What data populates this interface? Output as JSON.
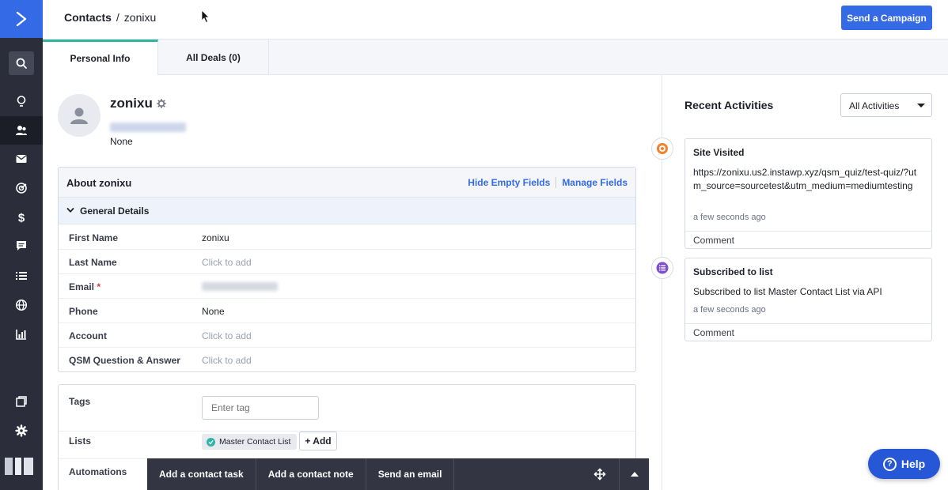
{
  "colors": {
    "brand": "#356ae6",
    "sidebar": "#2b2e3a",
    "accent_tab": "#2eb5a6",
    "required": "#d93b3b"
  },
  "sidebar": {
    "items": [
      {
        "icon": "search-icon"
      },
      {
        "icon": "lightbulb-icon"
      },
      {
        "icon": "contacts-icon"
      },
      {
        "icon": "mail-icon"
      },
      {
        "icon": "automation-icon"
      },
      {
        "icon": "dollar-icon"
      },
      {
        "icon": "chat-icon"
      },
      {
        "icon": "list-icon"
      },
      {
        "icon": "globe-icon"
      },
      {
        "icon": "reports-icon"
      },
      {
        "icon": "pages-icon"
      },
      {
        "icon": "gear-icon"
      }
    ]
  },
  "header": {
    "breadcrumb_root": "Contacts",
    "breadcrumb_sep": "/",
    "breadcrumb_current": "zonixu",
    "cta": "Send a Campaign"
  },
  "tabs": [
    {
      "label": "Personal Info"
    },
    {
      "label": "All Deals (0)"
    }
  ],
  "contact": {
    "name": "zonixu",
    "subtitle": "None"
  },
  "about": {
    "title": "About zonixu",
    "hide_empty": "Hide Empty Fields",
    "manage": "Manage Fields",
    "section": "General Details",
    "fields": [
      {
        "label": "First Name",
        "value": "zonixu"
      },
      {
        "label": "Last Name",
        "value": "Click to add"
      },
      {
        "label": "Email",
        "required": "*"
      },
      {
        "label": "Phone",
        "value": "None"
      },
      {
        "label": "Account",
        "value": "Click to add"
      },
      {
        "label": "QSM Question & Answer",
        "value": "Click to add"
      }
    ]
  },
  "tags": {
    "tags_label": "Tags",
    "tag_placeholder": "Enter tag",
    "lists_label": "Lists",
    "list_chip": "Master Contact List",
    "add_label": "+ Add",
    "automations_label": "Automations"
  },
  "action_bar": {
    "items": [
      "Add a contact task",
      "Add a contact note",
      "Send an email"
    ]
  },
  "activities": {
    "title": "Recent Activities",
    "filter": "All Activities",
    "items": [
      {
        "title": "Site Visited",
        "body": "https://zonixu.us2.instawp.xyz/qsm_quiz/test-quiz/?utm_source=sourcetest&utm_medium=mediumtesting",
        "time": "a few seconds ago",
        "comment": "Comment"
      },
      {
        "title": "Subscribed to list",
        "body": "Subscribed to list Master Contact List via API",
        "time": "a few seconds ago",
        "comment": "Comment"
      }
    ]
  },
  "help": {
    "label": "Help"
  }
}
